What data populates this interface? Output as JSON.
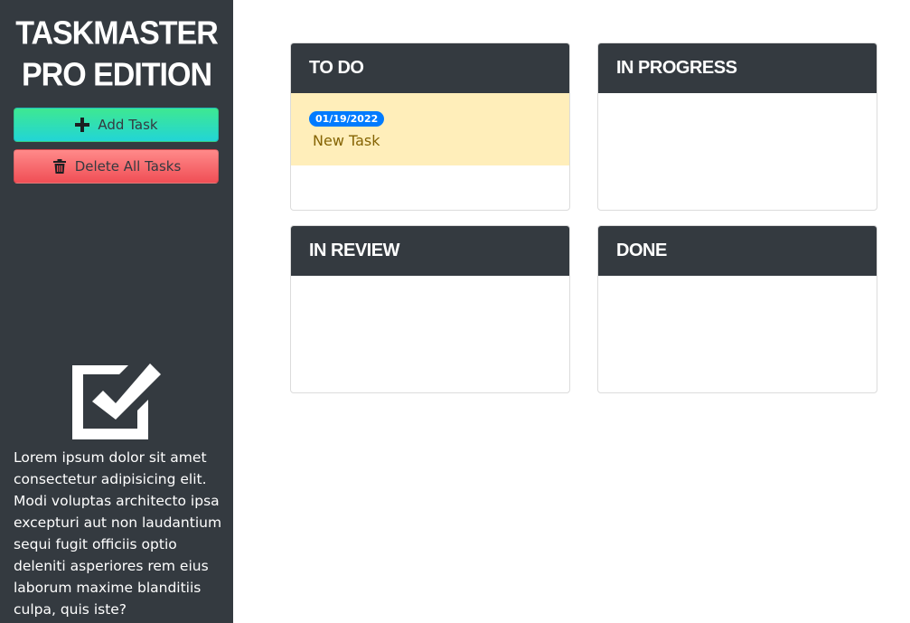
{
  "sidebar": {
    "brand_line1": "TASKMASTER",
    "brand_line2": "PRO EDITION",
    "add_label": "Add Task",
    "add_icon": "plus-icon",
    "delete_label": "Delete All Tasks",
    "delete_icon": "trash-icon",
    "logo_icon": "checkbox-icon",
    "blurb": "Lorem ipsum dolor sit amet consectetur adipisicing elit. Modi voluptas architecto ipsa excepturi aut non laudantium sequi fugit officiis optio deleniti asperiores rem eius laborum maxime blanditiis culpa, quis iste?"
  },
  "board": {
    "lanes": [
      {
        "title": "TO DO",
        "tasks": [
          {
            "date": "01/19/2022",
            "title": "New Task"
          }
        ]
      },
      {
        "title": "IN PROGRESS",
        "tasks": []
      },
      {
        "title": "IN REVIEW",
        "tasks": []
      },
      {
        "title": "DONE",
        "tasks": []
      }
    ]
  },
  "colors": {
    "sidebar_bg": "#343a40",
    "add_gradient": [
      "#3ee892",
      "#22d5d6"
    ],
    "delete_gradient": [
      "#ff8a8a",
      "#f04e55"
    ],
    "task_bg": "#ffeeba",
    "badge": "#007bff"
  }
}
